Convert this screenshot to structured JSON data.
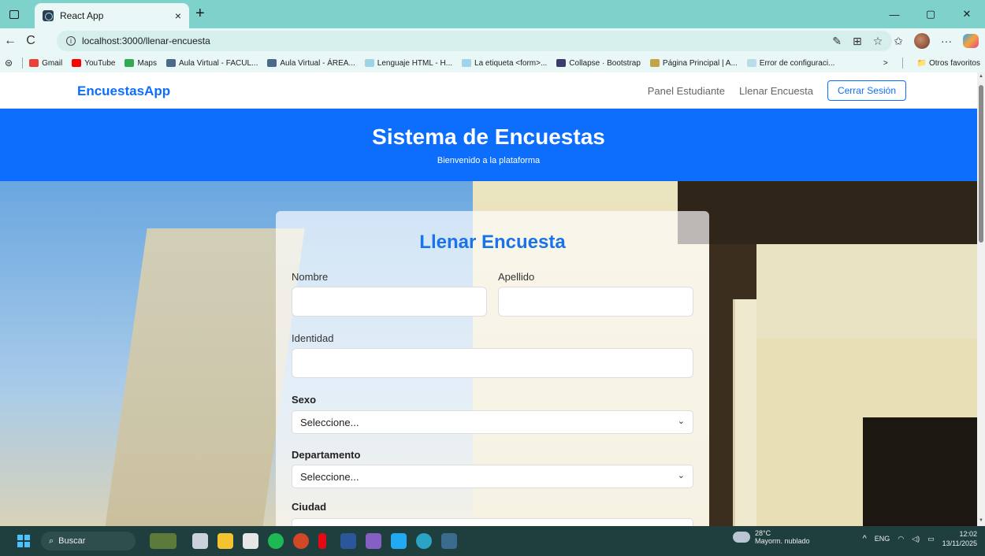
{
  "browser": {
    "tab_title": "React App",
    "tab_close": "×",
    "new_tab": "+",
    "url": "localhost:3000/llenar-encuesta",
    "win_min": "—",
    "win_max": "▢",
    "win_close": "✕"
  },
  "bookmarks": {
    "items": [
      {
        "label": "Gmail",
        "color": "#ea4335"
      },
      {
        "label": "YouTube",
        "color": "#ff0000"
      },
      {
        "label": "Maps",
        "color": "#34a853"
      },
      {
        "label": "Aula Virtual - FACUL...",
        "color": "#4a6a8a"
      },
      {
        "label": "Aula Virtual - ÁREA...",
        "color": "#4a6a8a"
      },
      {
        "label": "Lenguaje HTML - H...",
        "color": "#9fd3e6"
      },
      {
        "label": "La etiqueta <form>...",
        "color": "#9fd3e6"
      },
      {
        "label": "Collapse · Bootstrap",
        "color": "#3b3b6e"
      },
      {
        "label": "Página Principal | A...",
        "color": "#c4a24a"
      },
      {
        "label": "Error de configuraci...",
        "color": "#b8dde8"
      }
    ],
    "more": ">",
    "other_favorites": "Otros favoritos"
  },
  "navbar": {
    "brand": "EncuestasApp",
    "link_panel": "Panel Estudiante",
    "link_fill": "Llenar Encuesta",
    "logout": "Cerrar Sesión"
  },
  "hero": {
    "title": "Sistema de Encuestas",
    "subtitle": "Bienvenido a la plataforma"
  },
  "form": {
    "title": "Llenar Encuesta",
    "nombre_label": "Nombre",
    "apellido_label": "Apellido",
    "identidad_label": "Identidad",
    "sexo_label": "Sexo",
    "sexo_value": "Seleccione...",
    "departamento_label": "Departamento",
    "departamento_value": "Seleccione...",
    "ciudad_label": "Ciudad"
  },
  "taskbar": {
    "search_label": "Buscar",
    "weather_temp": "28°C",
    "weather_desc": "Mayorm. nublado",
    "language": "ENG",
    "time": "12:02",
    "date": "13/11/2025"
  },
  "colors": {
    "primary": "#0d6efd",
    "title_bar": "#7fd1cc",
    "taskbar": "#1f3f3f"
  }
}
